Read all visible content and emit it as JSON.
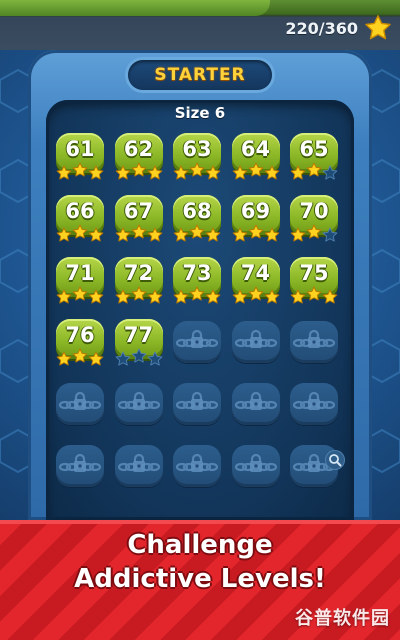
{
  "top": {
    "score_text": "220/360"
  },
  "header": {
    "title": "STARTER"
  },
  "board": {
    "size_label": "Size 6"
  },
  "levels": [
    {
      "num": "61",
      "stars": 3
    },
    {
      "num": "62",
      "stars": 3
    },
    {
      "num": "63",
      "stars": 3
    },
    {
      "num": "64",
      "stars": 3
    },
    {
      "num": "65",
      "stars": 2
    },
    {
      "num": "66",
      "stars": 3
    },
    {
      "num": "67",
      "stars": 3
    },
    {
      "num": "68",
      "stars": 3
    },
    {
      "num": "69",
      "stars": 3
    },
    {
      "num": "70",
      "stars": 2
    },
    {
      "num": "71",
      "stars": 3
    },
    {
      "num": "72",
      "stars": 3
    },
    {
      "num": "73",
      "stars": 3
    },
    {
      "num": "74",
      "stars": 3
    },
    {
      "num": "75",
      "stars": 3
    },
    {
      "num": "76",
      "stars": 3
    },
    {
      "num": "77",
      "stars": 0
    }
  ],
  "locked_count": 13,
  "banner": {
    "line1": "Challenge",
    "line2": "Addictive Levels!"
  },
  "watermark": "谷普软件园",
  "colors": {
    "star": "#ffd21f",
    "star_empty": "#1f4d7a",
    "level_green": "#8cb827",
    "banner_red": "#e3262c"
  },
  "icons": {
    "score": "star-icon",
    "locked": "chain-lock-icon",
    "zoom": "magnifier-icon"
  }
}
